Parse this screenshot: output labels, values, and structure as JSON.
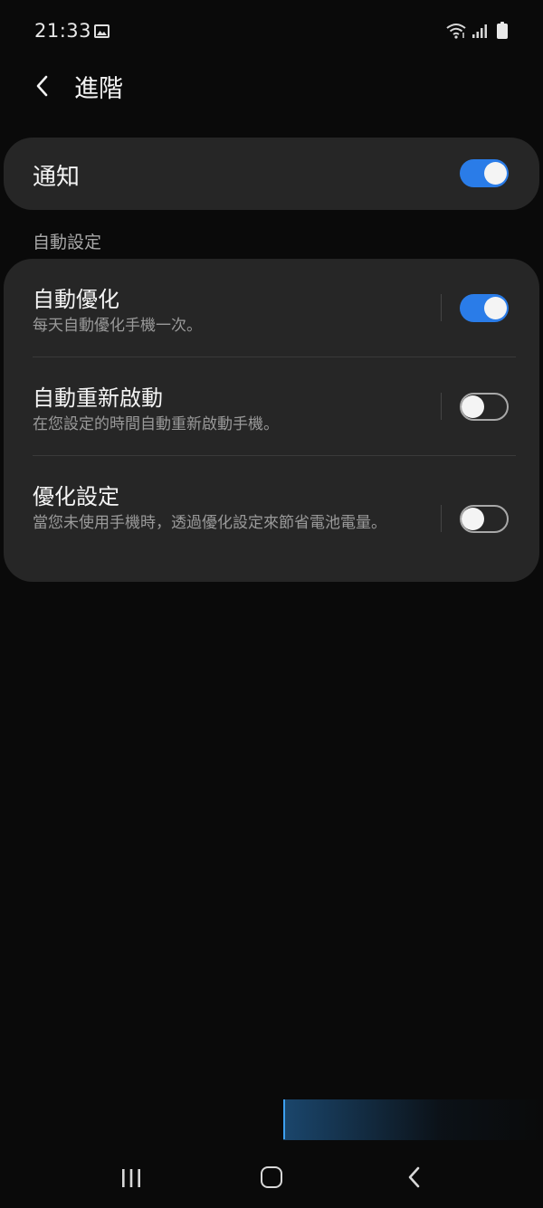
{
  "status_bar": {
    "time": "21:33",
    "icons": [
      "gallery-icon",
      "wifi-icon",
      "signal-icon",
      "battery-icon"
    ]
  },
  "header": {
    "title": "進階",
    "back_icon": "chevron-left-icon"
  },
  "notifications": {
    "label": "通知",
    "enabled": true
  },
  "auto_section": {
    "header": "自動設定",
    "items": [
      {
        "title": "自動優化",
        "description": "每天自動優化手機一次。",
        "enabled": true
      },
      {
        "title": "自動重新啟動",
        "description": "在您設定的時間自動重新啟動手機。",
        "enabled": false
      },
      {
        "title": "優化設定",
        "description": "當您未使用手機時，透過優化設定來節省電池電量。",
        "enabled": false
      }
    ]
  },
  "nav_bar": {
    "icons": [
      "recent-apps-icon",
      "home-icon",
      "back-icon"
    ]
  },
  "colors": {
    "background": "#0a0a0a",
    "card": "#262626",
    "accent": "#2a7ce8",
    "secondary_text": "#9a9a9a"
  }
}
